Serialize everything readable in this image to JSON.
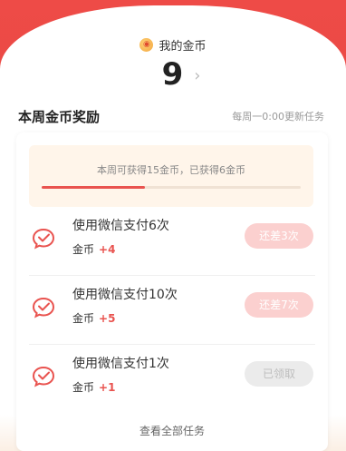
{
  "header": {
    "coin_label": "我的金币",
    "coin_count": "9",
    "chevron_glyph": "›"
  },
  "section": {
    "title": "本周金币奖励",
    "refresh_note": "每周一0:00更新任务"
  },
  "progress": {
    "text": "本周可获得15金币，已获得6金币",
    "fraction": 0.4
  },
  "tasks": [
    {
      "title": "使用微信支付6次",
      "reward_label": "金币",
      "reward_value": "+4",
      "button": "还差3次",
      "state": "pending",
      "icon": "wechat-pay-icon"
    },
    {
      "title": "使用微信支付10次",
      "reward_label": "金币",
      "reward_value": "+5",
      "button": "还差7次",
      "state": "pending",
      "icon": "wechat-pay-icon"
    },
    {
      "title": "使用微信支付1次",
      "reward_label": "金币",
      "reward_value": "+1",
      "button": "已领取",
      "state": "done",
      "icon": "wechat-pay-icon"
    }
  ],
  "footer": {
    "view_all": "查看全部任务"
  },
  "colors": {
    "brand_red": "#e9534f",
    "progress_bg": "#fff5ea"
  }
}
